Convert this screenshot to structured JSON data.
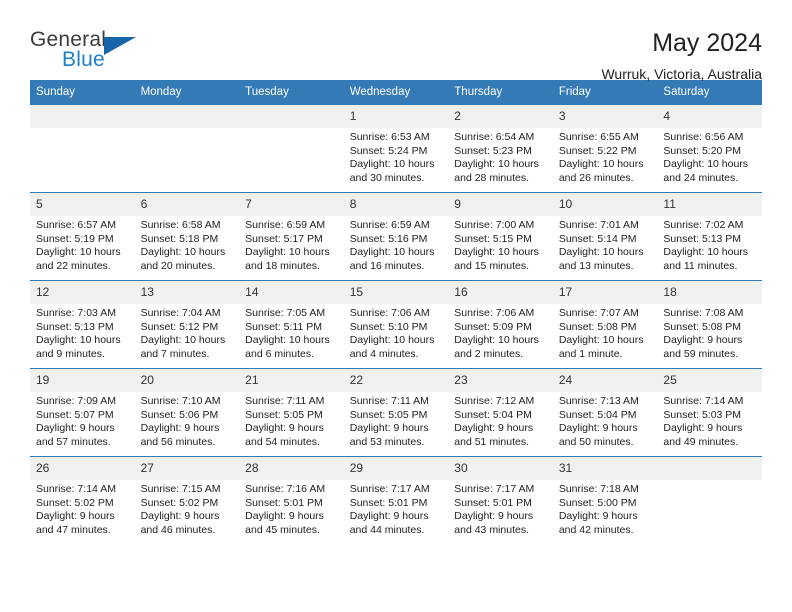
{
  "logo": {
    "word_top": "General",
    "word_bottom": "Blue",
    "triangle_color": "#1565a8",
    "blue_color": "#1f7fc4"
  },
  "header": {
    "title": "May 2024",
    "subtitle": "Wurruk, Victoria, Australia"
  },
  "theme": {
    "header_blue": "#337ab7",
    "daynum_band": "#f0f0f0",
    "text": "#222222"
  },
  "weekdays": [
    "Sunday",
    "Monday",
    "Tuesday",
    "Wednesday",
    "Thursday",
    "Friday",
    "Saturday"
  ],
  "weeks": [
    {
      "daynums": [
        "",
        "",
        "",
        "1",
        "2",
        "3",
        "4"
      ],
      "cells": [
        {
          "empty": true,
          "sunrise": "",
          "sunset": "",
          "daylight_1": "",
          "daylight_2": ""
        },
        {
          "empty": true,
          "sunrise": "",
          "sunset": "",
          "daylight_1": "",
          "daylight_2": ""
        },
        {
          "empty": true,
          "sunrise": "",
          "sunset": "",
          "daylight_1": "",
          "daylight_2": ""
        },
        {
          "empty": false,
          "sunrise": "Sunrise: 6:53 AM",
          "sunset": "Sunset: 5:24 PM",
          "daylight_1": "Daylight: 10 hours",
          "daylight_2": "and 30 minutes."
        },
        {
          "empty": false,
          "sunrise": "Sunrise: 6:54 AM",
          "sunset": "Sunset: 5:23 PM",
          "daylight_1": "Daylight: 10 hours",
          "daylight_2": "and 28 minutes."
        },
        {
          "empty": false,
          "sunrise": "Sunrise: 6:55 AM",
          "sunset": "Sunset: 5:22 PM",
          "daylight_1": "Daylight: 10 hours",
          "daylight_2": "and 26 minutes."
        },
        {
          "empty": false,
          "sunrise": "Sunrise: 6:56 AM",
          "sunset": "Sunset: 5:20 PM",
          "daylight_1": "Daylight: 10 hours",
          "daylight_2": "and 24 minutes."
        }
      ]
    },
    {
      "daynums": [
        "5",
        "6",
        "7",
        "8",
        "9",
        "10",
        "11"
      ],
      "cells": [
        {
          "empty": false,
          "sunrise": "Sunrise: 6:57 AM",
          "sunset": "Sunset: 5:19 PM",
          "daylight_1": "Daylight: 10 hours",
          "daylight_2": "and 22 minutes."
        },
        {
          "empty": false,
          "sunrise": "Sunrise: 6:58 AM",
          "sunset": "Sunset: 5:18 PM",
          "daylight_1": "Daylight: 10 hours",
          "daylight_2": "and 20 minutes."
        },
        {
          "empty": false,
          "sunrise": "Sunrise: 6:59 AM",
          "sunset": "Sunset: 5:17 PM",
          "daylight_1": "Daylight: 10 hours",
          "daylight_2": "and 18 minutes."
        },
        {
          "empty": false,
          "sunrise": "Sunrise: 6:59 AM",
          "sunset": "Sunset: 5:16 PM",
          "daylight_1": "Daylight: 10 hours",
          "daylight_2": "and 16 minutes."
        },
        {
          "empty": false,
          "sunrise": "Sunrise: 7:00 AM",
          "sunset": "Sunset: 5:15 PM",
          "daylight_1": "Daylight: 10 hours",
          "daylight_2": "and 15 minutes."
        },
        {
          "empty": false,
          "sunrise": "Sunrise: 7:01 AM",
          "sunset": "Sunset: 5:14 PM",
          "daylight_1": "Daylight: 10 hours",
          "daylight_2": "and 13 minutes."
        },
        {
          "empty": false,
          "sunrise": "Sunrise: 7:02 AM",
          "sunset": "Sunset: 5:13 PM",
          "daylight_1": "Daylight: 10 hours",
          "daylight_2": "and 11 minutes."
        }
      ]
    },
    {
      "daynums": [
        "12",
        "13",
        "14",
        "15",
        "16",
        "17",
        "18"
      ],
      "cells": [
        {
          "empty": false,
          "sunrise": "Sunrise: 7:03 AM",
          "sunset": "Sunset: 5:13 PM",
          "daylight_1": "Daylight: 10 hours",
          "daylight_2": "and 9 minutes."
        },
        {
          "empty": false,
          "sunrise": "Sunrise: 7:04 AM",
          "sunset": "Sunset: 5:12 PM",
          "daylight_1": "Daylight: 10 hours",
          "daylight_2": "and 7 minutes."
        },
        {
          "empty": false,
          "sunrise": "Sunrise: 7:05 AM",
          "sunset": "Sunset: 5:11 PM",
          "daylight_1": "Daylight: 10 hours",
          "daylight_2": "and 6 minutes."
        },
        {
          "empty": false,
          "sunrise": "Sunrise: 7:06 AM",
          "sunset": "Sunset: 5:10 PM",
          "daylight_1": "Daylight: 10 hours",
          "daylight_2": "and 4 minutes."
        },
        {
          "empty": false,
          "sunrise": "Sunrise: 7:06 AM",
          "sunset": "Sunset: 5:09 PM",
          "daylight_1": "Daylight: 10 hours",
          "daylight_2": "and 2 minutes."
        },
        {
          "empty": false,
          "sunrise": "Sunrise: 7:07 AM",
          "sunset": "Sunset: 5:08 PM",
          "daylight_1": "Daylight: 10 hours",
          "daylight_2": "and 1 minute."
        },
        {
          "empty": false,
          "sunrise": "Sunrise: 7:08 AM",
          "sunset": "Sunset: 5:08 PM",
          "daylight_1": "Daylight: 9 hours",
          "daylight_2": "and 59 minutes."
        }
      ]
    },
    {
      "daynums": [
        "19",
        "20",
        "21",
        "22",
        "23",
        "24",
        "25"
      ],
      "cells": [
        {
          "empty": false,
          "sunrise": "Sunrise: 7:09 AM",
          "sunset": "Sunset: 5:07 PM",
          "daylight_1": "Daylight: 9 hours",
          "daylight_2": "and 57 minutes."
        },
        {
          "empty": false,
          "sunrise": "Sunrise: 7:10 AM",
          "sunset": "Sunset: 5:06 PM",
          "daylight_1": "Daylight: 9 hours",
          "daylight_2": "and 56 minutes."
        },
        {
          "empty": false,
          "sunrise": "Sunrise: 7:11 AM",
          "sunset": "Sunset: 5:05 PM",
          "daylight_1": "Daylight: 9 hours",
          "daylight_2": "and 54 minutes."
        },
        {
          "empty": false,
          "sunrise": "Sunrise: 7:11 AM",
          "sunset": "Sunset: 5:05 PM",
          "daylight_1": "Daylight: 9 hours",
          "daylight_2": "and 53 minutes."
        },
        {
          "empty": false,
          "sunrise": "Sunrise: 7:12 AM",
          "sunset": "Sunset: 5:04 PM",
          "daylight_1": "Daylight: 9 hours",
          "daylight_2": "and 51 minutes."
        },
        {
          "empty": false,
          "sunrise": "Sunrise: 7:13 AM",
          "sunset": "Sunset: 5:04 PM",
          "daylight_1": "Daylight: 9 hours",
          "daylight_2": "and 50 minutes."
        },
        {
          "empty": false,
          "sunrise": "Sunrise: 7:14 AM",
          "sunset": "Sunset: 5:03 PM",
          "daylight_1": "Daylight: 9 hours",
          "daylight_2": "and 49 minutes."
        }
      ]
    },
    {
      "daynums": [
        "26",
        "27",
        "28",
        "29",
        "30",
        "31",
        ""
      ],
      "cells": [
        {
          "empty": false,
          "sunrise": "Sunrise: 7:14 AM",
          "sunset": "Sunset: 5:02 PM",
          "daylight_1": "Daylight: 9 hours",
          "daylight_2": "and 47 minutes."
        },
        {
          "empty": false,
          "sunrise": "Sunrise: 7:15 AM",
          "sunset": "Sunset: 5:02 PM",
          "daylight_1": "Daylight: 9 hours",
          "daylight_2": "and 46 minutes."
        },
        {
          "empty": false,
          "sunrise": "Sunrise: 7:16 AM",
          "sunset": "Sunset: 5:01 PM",
          "daylight_1": "Daylight: 9 hours",
          "daylight_2": "and 45 minutes."
        },
        {
          "empty": false,
          "sunrise": "Sunrise: 7:17 AM",
          "sunset": "Sunset: 5:01 PM",
          "daylight_1": "Daylight: 9 hours",
          "daylight_2": "and 44 minutes."
        },
        {
          "empty": false,
          "sunrise": "Sunrise: 7:17 AM",
          "sunset": "Sunset: 5:01 PM",
          "daylight_1": "Daylight: 9 hours",
          "daylight_2": "and 43 minutes."
        },
        {
          "empty": false,
          "sunrise": "Sunrise: 7:18 AM",
          "sunset": "Sunset: 5:00 PM",
          "daylight_1": "Daylight: 9 hours",
          "daylight_2": "and 42 minutes."
        },
        {
          "empty": true,
          "sunrise": "",
          "sunset": "",
          "daylight_1": "",
          "daylight_2": ""
        }
      ]
    }
  ]
}
